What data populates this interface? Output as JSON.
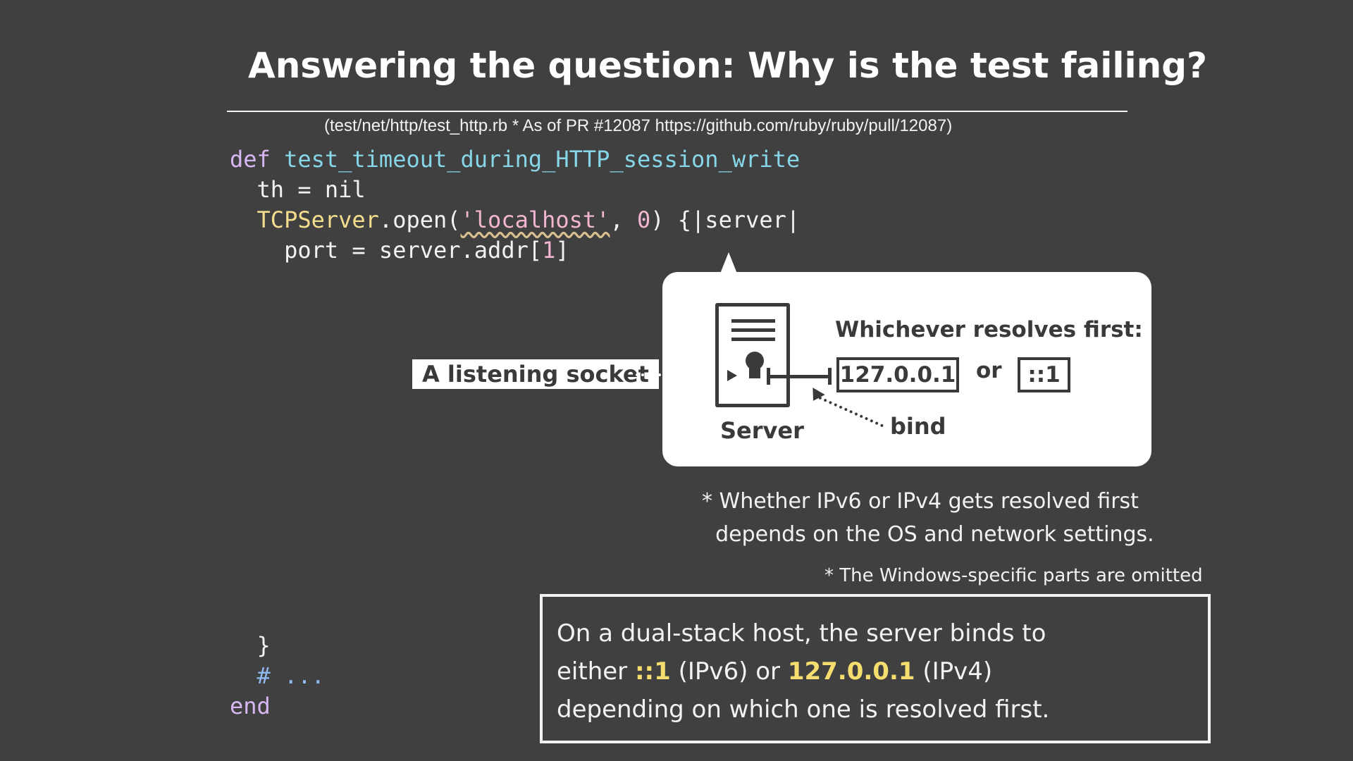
{
  "title": "Answering the question: Why is the test failing?",
  "source_note": "(test/net/http/test_http.rb * As of PR #12087 https://github.com/ruby/ruby/pull/12087)",
  "code": {
    "line1_kw": "def",
    "line1_fn": "test_timeout_during_HTTP_session_write",
    "line2": "th = nil",
    "line3_cls": "TCPServer",
    "line3_mid": ".open(",
    "line3_str": "'localhost'",
    "line3_sep": ", ",
    "line3_num": "0",
    "line3_end": ") {|server|",
    "line4_a": "port = server.addr[",
    "line4_num": "1",
    "line4_b": "]",
    "close_brace": "}",
    "comment": "# ...",
    "end_kw": "end"
  },
  "diagram": {
    "listen_label": "A listening socket",
    "server_label": "Server",
    "whichever": "Whichever resolves first:",
    "addr_ipv4": "127.0.0.1",
    "or": "or",
    "addr_ipv6": "::1",
    "bind": "bind"
  },
  "notes": {
    "resolve_note": "* Whether IPv6 or IPv4 gets resolved first\n  depends on the OS and network settings.",
    "windows_note": "* The Windows-specific parts are omitted"
  },
  "summary": {
    "line1": "On a dual-stack host, the server binds to",
    "line2_a": "either ",
    "line2_ipv6": "::1",
    "line2_b": " (IPv6) or ",
    "line2_ipv4": "127.0.0.1",
    "line2_c": " (IPv4)",
    "line3": "depending on which one is resolved first."
  },
  "colors": {
    "background": "#404040",
    "keyword": "#d7b8f3",
    "function": "#87d6e8",
    "class": "#f5dd8e",
    "highlight": "#f5dd6e"
  }
}
